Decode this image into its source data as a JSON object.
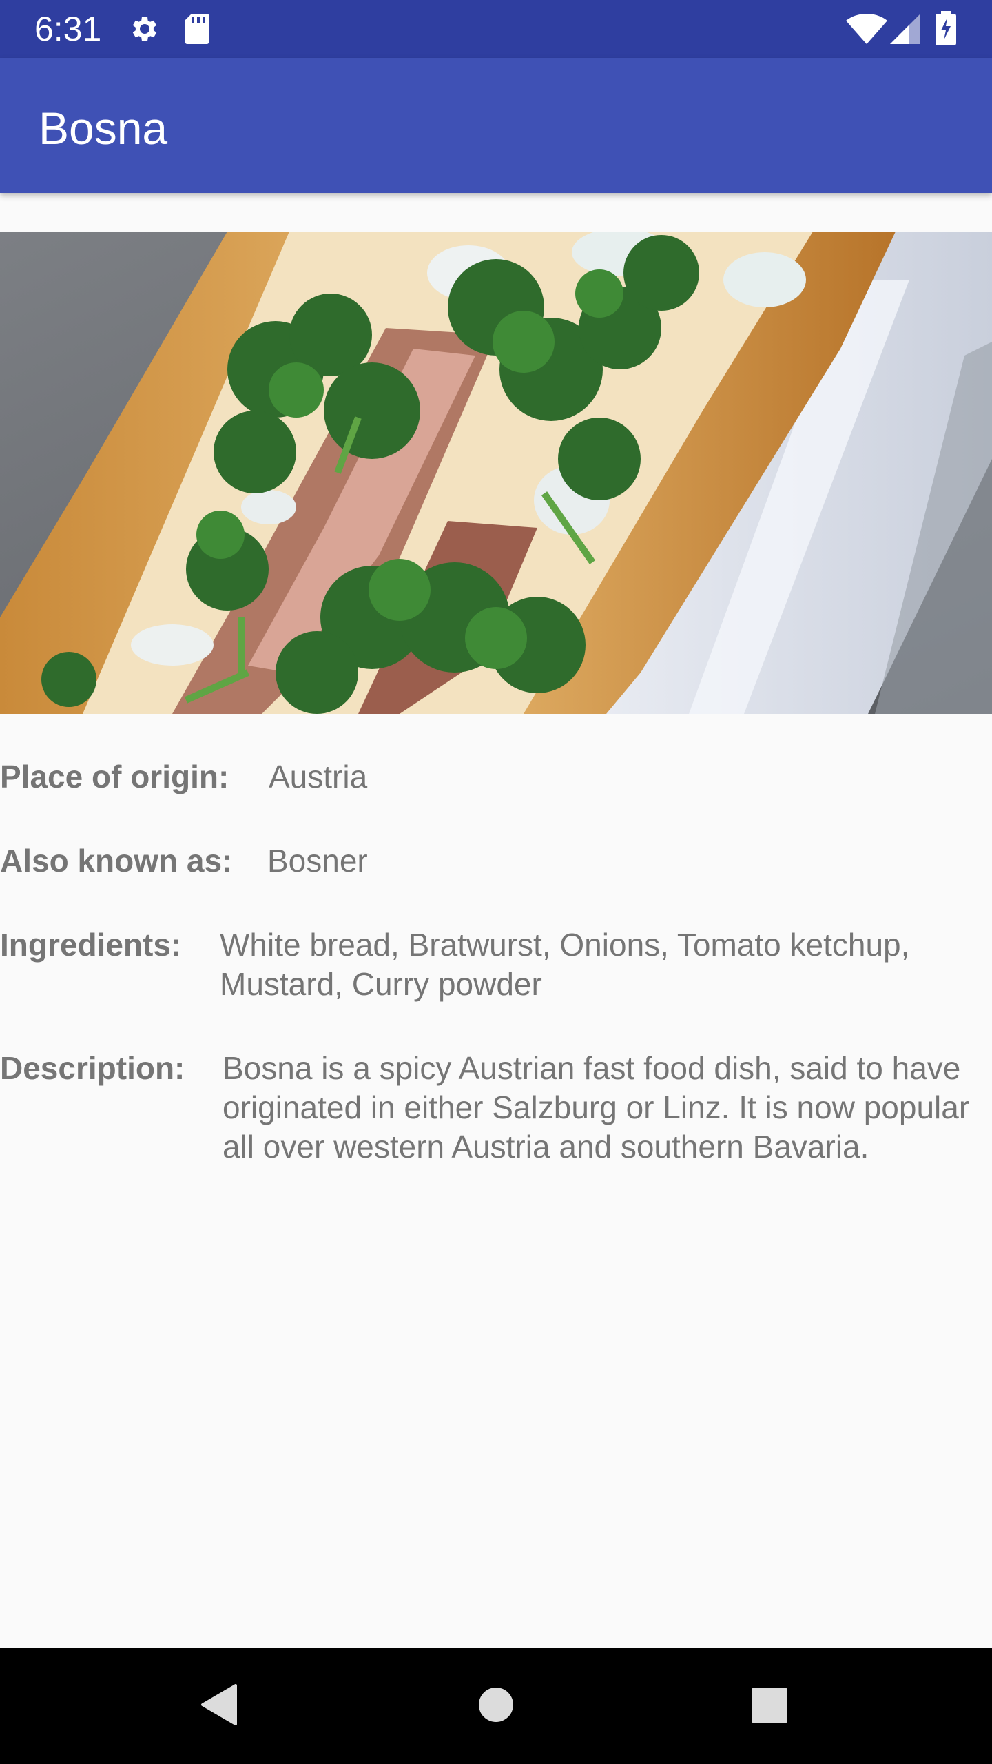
{
  "status_bar": {
    "time": "6:31",
    "icons": [
      "gear-icon",
      "sd-card-icon",
      "wifi-icon",
      "signal-icon",
      "battery-charging-icon"
    ]
  },
  "app_bar": {
    "title": "Bosna",
    "color": "#3f51b5",
    "status_color": "#2f3ea0"
  },
  "hero_image": {
    "description_icon": "bosna-photo"
  },
  "details": {
    "origin_label": "Place of origin:",
    "origin_value": "Austria",
    "aka_label": "Also known as:",
    "aka_value": "Bosner",
    "ingredients_label": "Ingredients:",
    "ingredients_value": "White bread, Bratwurst, Onions, Tomato ketchup, Mustard, Curry powder",
    "description_label": "Description:",
    "description_value": "Bosna is a spicy Austrian fast food dish, said to have originated in either Salzburg or Linz. It is now popular all over western Austria and southern Bavaria."
  },
  "nav_bar": {
    "icons": [
      "back-icon",
      "home-icon",
      "recents-icon"
    ]
  }
}
